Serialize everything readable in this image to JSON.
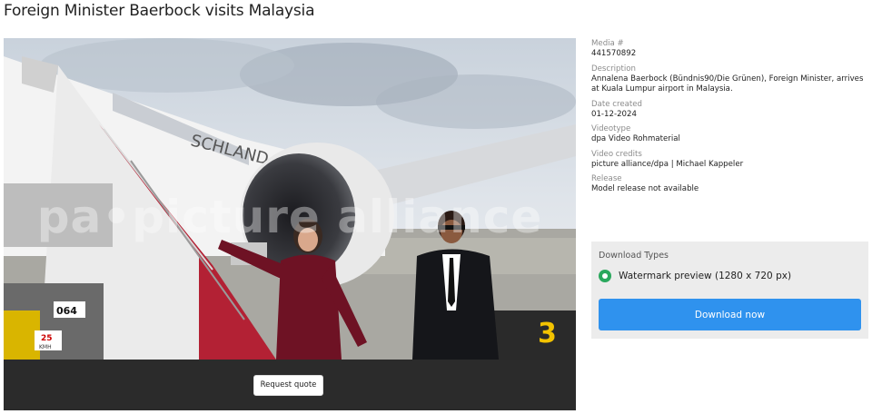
{
  "page": {
    "title": "Foreign Minister Baerbock visits Malaysia"
  },
  "media": {
    "watermark": "pa•picture alliance",
    "plane_text": "SCHLAND",
    "stand_number": "3",
    "vehicle_label": "064",
    "speed_sign": "25",
    "speed_unit": "KMH",
    "request_quote_label": "Request quote"
  },
  "details": [
    {
      "label": "Media #",
      "value": "441570892"
    },
    {
      "label": "Description",
      "value": "Annalena Baerbock (Bündnis90/Die Grünen), Foreign Minister, arrives at Kuala Lumpur airport in Malaysia."
    },
    {
      "label": "Date created",
      "value": "01-12-2024"
    },
    {
      "label": "Videotype",
      "value": "dpa Video Rohmaterial"
    },
    {
      "label": "Video credits",
      "value": "picture alliance/dpa | Michael Kappeler"
    },
    {
      "label": "Release",
      "value": "Model release not available"
    }
  ],
  "download": {
    "title": "Download Types",
    "option_label": "Watermark preview (1280 x 720 px)",
    "button_label": "Download now",
    "accent_color": "#2f92ee",
    "radio_color": "#2aa85d"
  }
}
